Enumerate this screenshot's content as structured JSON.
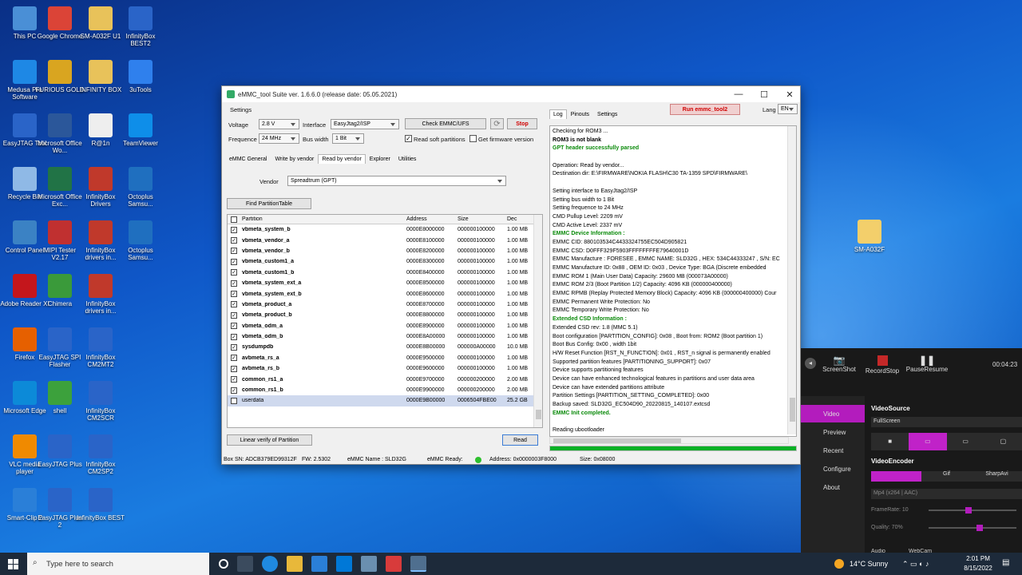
{
  "desktop": {
    "icons": [
      {
        "label": "This PC",
        "color": "#4a8fd6"
      },
      {
        "label": "Google Chrome",
        "color": "#db4437"
      },
      {
        "label": "SM-A032F U1",
        "color": "#e8c25a"
      },
      {
        "label": "InfinityBox BEST2",
        "color": "#2a64c8"
      },
      {
        "label": "Medusa Pro Software",
        "color": "#1e88e5"
      },
      {
        "label": "FURIOUS GOLD",
        "color": "#d9a520"
      },
      {
        "label": "INFINITY BOX",
        "color": "#e8c25a"
      },
      {
        "label": "3uTools",
        "color": "#2f80ed"
      },
      {
        "label": "EasyJTAG Tool",
        "color": "#2a64c8"
      },
      {
        "label": "Microsoft Office Wo...",
        "color": "#2b579a"
      },
      {
        "label": "R@1n",
        "color": "#eeeeee"
      },
      {
        "label": "TeamViewer",
        "color": "#0e8ee9"
      },
      {
        "label": "Recycle Bin",
        "color": "#8fb9e6"
      },
      {
        "label": "Microsoft Office Exc...",
        "color": "#217346"
      },
      {
        "label": "InfinityBox Drivers",
        "color": "#c0392b"
      },
      {
        "label": "Octoplus Samsu...",
        "color": "#1f6fbf"
      },
      {
        "label": "Control Panel",
        "color": "#3b82c4"
      },
      {
        "label": "MIPI Tester V2.17",
        "color": "#c03030"
      },
      {
        "label": "InfinityBox drivers in...",
        "color": "#c0392b"
      },
      {
        "label": "Octoplus Samsu...",
        "color": "#1f6fbf"
      },
      {
        "label": "Adobe Reader XI",
        "color": "#c4161c"
      },
      {
        "label": "Chimera",
        "color": "#3a9a3a"
      },
      {
        "label": "InfinityBox drivers in...",
        "color": "#c0392b"
      },
      {
        "label": "Firefox",
        "color": "#e66000"
      },
      {
        "label": "EasyJTAG SPI Flasher",
        "color": "#2a64c8"
      },
      {
        "label": "InfinityBox CM2MT2",
        "color": "#2a64c8"
      },
      {
        "label": "Microsoft Edge",
        "color": "#0c8ad8"
      },
      {
        "label": "shell",
        "color": "#3ca13c"
      },
      {
        "label": "InfinityBox CM2SCR",
        "color": "#2a64c8"
      },
      {
        "label": "VLC media player",
        "color": "#f08a00"
      },
      {
        "label": "EasyJTAG Plus",
        "color": "#2a64c8"
      },
      {
        "label": "InfinityBox CM2SP2",
        "color": "#2a64c8"
      },
      {
        "label": "Smart-Clip 2",
        "color": "#2a7fd8"
      },
      {
        "label": "EasyJTAG Plus 2",
        "color": "#2a64c8"
      },
      {
        "label": "InfinityBox BEST",
        "color": "#2a64c8"
      }
    ],
    "folder_right": "SM-A032F"
  },
  "window": {
    "title": "eMMC_tool Suite  ver. 1.6.6.0 (release date: 05.05.2021)",
    "minimize": "—",
    "maximize": "☐",
    "close": "✕"
  },
  "settings": {
    "group": "Settings",
    "voltage_label": "Voltage",
    "voltage": "2.8 V",
    "interface_label": "Interface",
    "interface": "EasyJtag2/ISP",
    "frequence_label": "Frequence",
    "frequence": "24 MHz",
    "buswidth_label": "Bus width",
    "buswidth": "1 Bit",
    "check_button": "Check EMMC/UFS",
    "stop_button": "Stop",
    "read_soft_partitions": "Read soft partitions",
    "get_firmware_version": "Get firmware version"
  },
  "tabs": [
    "eMMC General",
    "Write by vendor",
    "Read by vendor",
    "Explorer",
    "Utilities"
  ],
  "vendor_label": "Vendor",
  "vendor_value": "Spreadtrum (GPT)",
  "find_partition_button": "Find PartitionTable",
  "table": {
    "headers": [
      "Partition",
      "Address",
      "Size",
      "Dec"
    ],
    "rows": [
      {
        "name": "vbmeta_system_b",
        "address": "0000E8000000",
        "size": "000000100000",
        "dec": "1.00 MB",
        "checked": true
      },
      {
        "name": "vbmeta_vendor_a",
        "address": "0000E8100000",
        "size": "000000100000",
        "dec": "1.00 MB",
        "checked": true
      },
      {
        "name": "vbmeta_vendor_b",
        "address": "0000E8200000",
        "size": "000000100000",
        "dec": "1.00 MB",
        "checked": true
      },
      {
        "name": "vbmeta_custom1_a",
        "address": "0000E8300000",
        "size": "000000100000",
        "dec": "1.00 MB",
        "checked": true
      },
      {
        "name": "vbmeta_custom1_b",
        "address": "0000E8400000",
        "size": "000000100000",
        "dec": "1.00 MB",
        "checked": true
      },
      {
        "name": "vbmeta_system_ext_a",
        "address": "0000E8500000",
        "size": "000000100000",
        "dec": "1.00 MB",
        "checked": true
      },
      {
        "name": "vbmeta_system_ext_b",
        "address": "0000E8600000",
        "size": "000000100000",
        "dec": "1.00 MB",
        "checked": true
      },
      {
        "name": "vbmeta_product_a",
        "address": "0000E8700000",
        "size": "000000100000",
        "dec": "1.00 MB",
        "checked": true
      },
      {
        "name": "vbmeta_product_b",
        "address": "0000E8800000",
        "size": "000000100000",
        "dec": "1.00 MB",
        "checked": true
      },
      {
        "name": "vbmeta_odm_a",
        "address": "0000E8900000",
        "size": "000000100000",
        "dec": "1.00 MB",
        "checked": true
      },
      {
        "name": "vbmeta_odm_b",
        "address": "0000E8A00000",
        "size": "000000100000",
        "dec": "1.00 MB",
        "checked": true
      },
      {
        "name": "sysdumpdb",
        "address": "0000E8B00000",
        "size": "000000A00000",
        "dec": "10.0 MB",
        "checked": true
      },
      {
        "name": "avbmeta_rs_a",
        "address": "0000E9500000",
        "size": "000000100000",
        "dec": "1.00 MB",
        "checked": true
      },
      {
        "name": "avbmeta_rs_b",
        "address": "0000E9600000",
        "size": "000000100000",
        "dec": "1.00 MB",
        "checked": true
      },
      {
        "name": "common_rs1_a",
        "address": "0000E9700000",
        "size": "000000200000",
        "dec": "2.00 MB",
        "checked": true
      },
      {
        "name": "common_rs1_b",
        "address": "0000E9900000",
        "size": "000000200000",
        "dec": "2.00 MB",
        "checked": true
      },
      {
        "name": "userdata",
        "address": "0000E9B00000",
        "size": "0006504FBE00",
        "dec": "25.2 GB",
        "checked": false
      }
    ]
  },
  "linear_verify_button": "Linear verify of Partition",
  "read_button": "Read",
  "right_tabs": [
    "Log",
    "Pinouts",
    "Settings"
  ],
  "run_tool2_button": "Run emmc_tool2",
  "lang_label": "Lang",
  "lang_value": "EN",
  "log_lines": [
    {
      "t": "Checking for ROM3 ...",
      "s": "n"
    },
    {
      "t": "ROM3 is not blank",
      "s": "b"
    },
    {
      "t": "GPT header successfully parsed",
      "s": "g"
    },
    {
      "t": "",
      "s": "n"
    },
    {
      "t": "Operation: Read by vendor...",
      "s": "n"
    },
    {
      "t": "Destination dir: E:\\FIRMWARE\\NOKIA FLASH\\C30 TA-1359 SPD\\FIRMWARE\\",
      "s": "n"
    },
    {
      "t": "",
      "s": "n"
    },
    {
      "t": "Setting interface to EasyJtag2/ISP",
      "s": "n"
    },
    {
      "t": "Setting bus width to 1 Bit",
      "s": "n"
    },
    {
      "t": "Setting frequence to 24 MHz",
      "s": "n"
    },
    {
      "t": "CMD Pullup Level: 2209 mV",
      "s": "n"
    },
    {
      "t": "CMD Active Level: 2337 mV",
      "s": "n"
    },
    {
      "t": "EMMC Device Information :",
      "s": "g"
    },
    {
      "t": "EMMC CID: 880103534C4433324755EC504D905821",
      "s": "n"
    },
    {
      "t": "EMMC CSD: D0FFF329F5903FFFFFFFFE79640001D",
      "s": "n"
    },
    {
      "t": "EMMC Manufacture : FORESEE , EMMC NAME: SLD32G , HEX: 534C44333247 , S/N: EC",
      "s": "n"
    },
    {
      "t": "EMMC Manufacture ID: 0x88 , OEM ID: 0x03 , Device Type: BGA (Discrete embedded",
      "s": "n"
    },
    {
      "t": "  EMMC ROM 1 (Main User Data) Capacity: 29600 MB (000073A00000)",
      "s": "n"
    },
    {
      "t": "  EMMC ROM 2/3 (Boot Partition 1/2) Capacity: 4096 KB (000000400000)",
      "s": "n"
    },
    {
      "t": "  EMMC RPMB (Replay Protected Memory Block) Capacity: 4096 KB (000000400000) Cour",
      "s": "n"
    },
    {
      "t": "EMMC Permanent Write Protection: No",
      "s": "n"
    },
    {
      "t": "EMMC Temporary Write Protection: No",
      "s": "n"
    },
    {
      "t": "Extended CSD Information :",
      "s": "g"
    },
    {
      "t": "Extended CSD rev: 1.8 (MMC 5.1)",
      "s": "n"
    },
    {
      "t": "Boot configuration [PARTITION_CONFIG]: 0x08 , Boot from: ROM2 (Boot partition 1)",
      "s": "n"
    },
    {
      "t": "Boot Bus Config: 0x00 , width 1bit",
      "s": "n"
    },
    {
      "t": "H/W Reset Function [RST_N_FUNCTION]: 0x01 , RST_n signal is permanently enabled",
      "s": "n"
    },
    {
      "t": "Supported partition features [PARTITIONING_SUPPORT]: 0x07",
      "s": "n"
    },
    {
      "t": "Device supports partitioning features",
      "s": "n"
    },
    {
      "t": "Device can have enhanced technological features in partitions and user data area",
      "s": "n"
    },
    {
      "t": "Device can have extended partitions attribute",
      "s": "n"
    },
    {
      "t": "Partition Settings [PARTITION_SETTING_COMPLETED]: 0x00",
      "s": "n"
    },
    {
      "t": "Backup saved: SLD32G_EC504D90_20220815_140107.extcsd",
      "s": "n"
    },
    {
      "t": "EMMC Init completed.",
      "s": "g"
    },
    {
      "t": "",
      "s": "n"
    },
    {
      "t": "Reading ubootloader",
      "s": "n"
    }
  ],
  "progress_fraction": 1.0,
  "status": {
    "box_sn": "Box SN:  ADCB379ED99312F",
    "fw": "FW:  2.5302",
    "emmc_name": "eMMC Name : SLD32G",
    "emmc_ready": "eMMC Ready:",
    "address": "Address: 0x0000003F8000",
    "size": "Size: 0x08000"
  },
  "recorder": {
    "screenshot": "ScreenShot",
    "recordstop": "RecordStop",
    "pauseresume": "PauseResume",
    "time": "00:04:23",
    "menu": [
      "Video",
      "Preview",
      "Recent",
      "Configure",
      "About"
    ],
    "videosource_label": "VideoSource",
    "videosource_value": "FullScreen",
    "videoencoder_label": "VideoEncoder",
    "encoders": [
      "",
      "Gif",
      "SharpAvi"
    ],
    "codec": "Mp4 (x264 | AAC)",
    "framerate_label": "FrameRate:  10",
    "quality_label": "Quality:   70%",
    "audio_label": "Audio",
    "webcam_label": "WebCam"
  },
  "taskbar": {
    "search_placeholder": "Type here to search",
    "weather": "14°C  Sunny",
    "time": "2:01 PM",
    "date": "8/15/2022"
  }
}
